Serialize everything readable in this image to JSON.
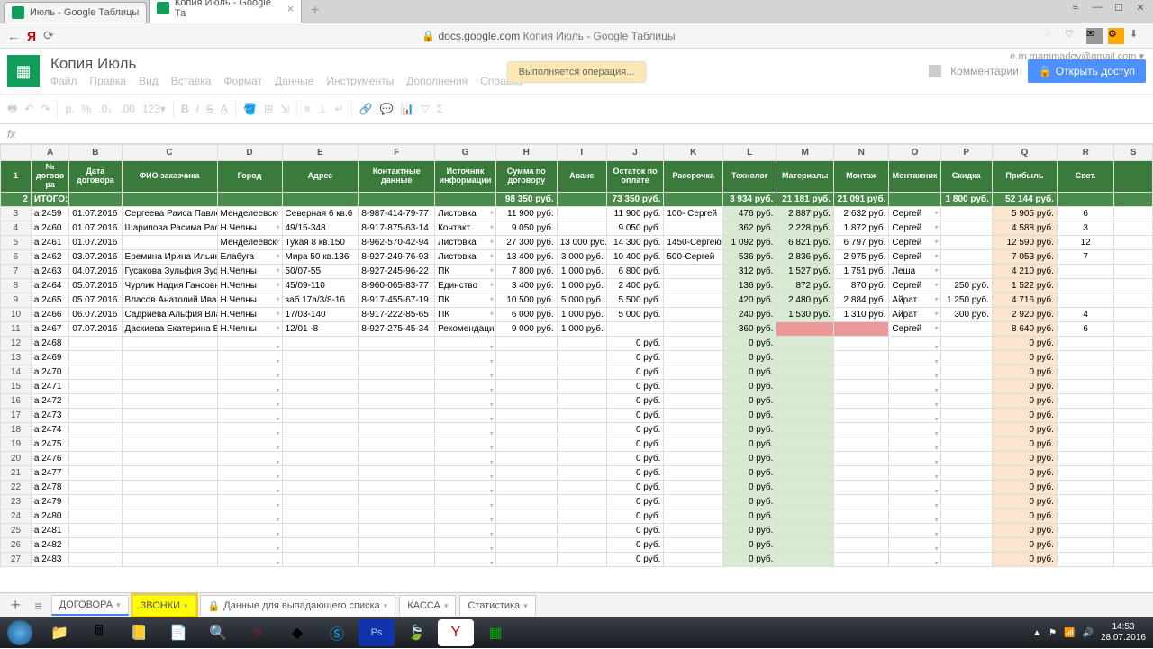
{
  "browser": {
    "tabs": [
      {
        "title": "Июль - Google Таблицы",
        "active": false
      },
      {
        "title": "Копия Июль - Google Та",
        "active": true
      }
    ],
    "url_host": "docs.google.com",
    "url_title": "Копия Июль - Google Таблицы"
  },
  "doc": {
    "title": "Копия Июль",
    "user_email": "e.m.mammadov@gmail.com ▾",
    "operation": "Выполняется операция...",
    "comments": "Комментарии",
    "share": "Открыть доступ"
  },
  "menus": [
    "Файл",
    "Правка",
    "Вид",
    "Вставка",
    "Формат",
    "Данные",
    "Инструменты",
    "Дополнения",
    "Справка"
  ],
  "columns": [
    "",
    "A",
    "B",
    "C",
    "D",
    "E",
    "F",
    "G",
    "H",
    "I",
    "J",
    "K",
    "L",
    "M",
    "N",
    "O",
    "P",
    "Q",
    "R",
    "S"
  ],
  "headers": [
    "№ догово ра",
    "Дата договора",
    "ФИО заказчика",
    "Город",
    "Адрес",
    "Контактные данные",
    "Источник информации",
    "Сумма по договору",
    "Аванс",
    "Остаток по оплате",
    "Рассрочка",
    "Технолог",
    "Материалы",
    "Монтаж",
    "Монтажник",
    "Скидка",
    "Прибыль",
    "Свет."
  ],
  "totals": {
    "label": "ИТОГО:",
    "H": "98 350 руб.",
    "J": "73 350 руб.",
    "L": "3 934 руб.",
    "M": "21 181 руб.",
    "N": "21 091 руб.",
    "P": "1 800 руб.",
    "Q": "52 144 руб."
  },
  "rows": [
    {
      "n": 3,
      "A": "а 2459",
      "B": "01.07.2016",
      "C": "Сергеева Раиса Павло",
      "D": "Менделеевск",
      "E": "Северная 6 кв.6",
      "F": "8-987-414-79-77",
      "G": "Листовка",
      "H": "11 900 руб.",
      "I": "",
      "J": "11 900 руб.",
      "K": "100- Сергей",
      "L": "476 руб.",
      "M": "2 887 руб.",
      "N": "2 632 руб.",
      "O": "Сергей",
      "P": "",
      "Q": "5 905 руб.",
      "R": "6"
    },
    {
      "n": 4,
      "A": "а 2460",
      "B": "01.07.2016",
      "C": "Шарипова Расима Раф",
      "D": "Н.Челны",
      "E": "49/15-348",
      "F": "8-917-875-63-14",
      "G": "Контакт",
      "H": "9 050 руб.",
      "I": "",
      "J": "9 050 руб.",
      "K": "",
      "L": "362 руб.",
      "M": "2 228 руб.",
      "N": "1 872 руб.",
      "O": "Сергей",
      "P": "",
      "Q": "4 588 руб.",
      "R": "3"
    },
    {
      "n": 5,
      "A": "а 2461",
      "B": "01.07.2016",
      "C": "",
      "D": "Менделеевск",
      "E": "Тукая 8 кв.150",
      "F": "8-962-570-42-94",
      "G": "Листовка",
      "H": "27 300 руб.",
      "I": "13 000 руб.",
      "J": "14 300 руб.",
      "K": "1450-Сергею",
      "L": "1 092 руб.",
      "M": "6 821 руб.",
      "N": "6 797 руб.",
      "O": "Сергей",
      "P": "",
      "Q": "12 590 руб.",
      "R": "12"
    },
    {
      "n": 6,
      "A": "а 2462",
      "B": "03.07.2016",
      "C": "Еремина Ирина Ильин",
      "D": "Елабуга",
      "E": "Мира 50 кв.136",
      "F": "8-927-249-76-93",
      "G": "Листовка",
      "H": "13 400 руб.",
      "I": "3 000 руб.",
      "J": "10 400 руб.",
      "K": "500-Сергей",
      "L": "536 руб.",
      "M": "2 836 руб.",
      "N": "2 975 руб.",
      "O": "Сергей",
      "P": "",
      "Q": "7 053 руб.",
      "R": "7"
    },
    {
      "n": 7,
      "A": "а 2463",
      "B": "04.07.2016",
      "C": "Гусакова Зульфия Зуф",
      "D": "Н.Челны",
      "E": "50/07-55",
      "F": "8-927-245-96-22",
      "G": "ПК",
      "H": "7 800 руб.",
      "I": "1 000 руб.",
      "J": "6 800 руб.",
      "K": "",
      "L": "312 руб.",
      "M": "1 527 руб.",
      "N": "1 751 руб.",
      "O": "Леша",
      "P": "",
      "Q": "4 210 руб.",
      "R": ""
    },
    {
      "n": 8,
      "A": "а 2464",
      "B": "05.07.2016",
      "C": "Чурлик Надия Гансовн",
      "D": "Н.Челны",
      "E": "45/09-110",
      "F": "8-960-065-83-77",
      "G": "Единство",
      "H": "3 400 руб.",
      "I": "1 000 руб.",
      "J": "2 400 руб.",
      "K": "",
      "L": "136 руб.",
      "M": "872 руб.",
      "N": "870 руб.",
      "O": "Сергей",
      "P": "250 руб.",
      "Q": "1 522 руб.",
      "R": ""
    },
    {
      "n": 9,
      "A": "а 2465",
      "B": "05.07.2016",
      "C": "Власов Анатолий Иван",
      "D": "Н.Челны",
      "E": "заб 17а/3/8-16",
      "F": "8-917-455-67-19",
      "G": "ПК",
      "H": "10 500 руб.",
      "I": "5 000 руб.",
      "J": "5 500 руб.",
      "K": "",
      "L": "420 руб.",
      "M": "2 480 руб.",
      "N": "2 884 руб.",
      "O": "Айрат",
      "P": "1 250 руб.",
      "Q": "4 716 руб.",
      "R": ""
    },
    {
      "n": 10,
      "A": "а 2466",
      "B": "06.07.2016",
      "C": "Садриева Альфия Вла",
      "D": "Н.Челны",
      "E": "17/03-140",
      "F": "8-917-222-85-65",
      "G": "ПК",
      "H": "6 000 руб.",
      "I": "1 000 руб.",
      "J": "5 000 руб.",
      "K": "",
      "L": "240 руб.",
      "M": "1 530 руб.",
      "N": "1 310 руб.",
      "O": "Айрат",
      "P": "300 руб.",
      "Q": "2 920 руб.",
      "R": "4"
    },
    {
      "n": 11,
      "A": "а 2467",
      "B": "07.07.2016",
      "C": "Даскиева Екатерина В",
      "D": "Н.Челны",
      "E": "12/01 -8",
      "F": "8-927-275-45-34",
      "G": "Рекомендаци",
      "H": "9 000 руб.",
      "I": "1 000 руб.",
      "J": "",
      "K": "",
      "L": "360 руб.",
      "M": "",
      "N": "",
      "O": "Сергей",
      "P": "",
      "Q": "8 640 руб.",
      "R": "6",
      "redMN": true
    },
    {
      "n": 12,
      "A": "а 2468",
      "J": "0 руб.",
      "L": "0 руб.",
      "Q": "0 руб."
    },
    {
      "n": 13,
      "A": "а 2469",
      "J": "0 руб.",
      "L": "0 руб.",
      "Q": "0 руб."
    },
    {
      "n": 14,
      "A": "а 2470",
      "J": "0 руб.",
      "L": "0 руб.",
      "Q": "0 руб."
    },
    {
      "n": 15,
      "A": "а 2471",
      "J": "0 руб.",
      "L": "0 руб.",
      "Q": "0 руб."
    },
    {
      "n": 16,
      "A": "а 2472",
      "J": "0 руб.",
      "L": "0 руб.",
      "Q": "0 руб."
    },
    {
      "n": 17,
      "A": "а 2473",
      "J": "0 руб.",
      "L": "0 руб.",
      "Q": "0 руб."
    },
    {
      "n": 18,
      "A": "а 2474",
      "J": "0 руб.",
      "L": "0 руб.",
      "Q": "0 руб."
    },
    {
      "n": 19,
      "A": "а 2475",
      "J": "0 руб.",
      "L": "0 руб.",
      "Q": "0 руб."
    },
    {
      "n": 20,
      "A": "а 2476",
      "J": "0 руб.",
      "L": "0 руб.",
      "Q": "0 руб."
    },
    {
      "n": 21,
      "A": "а 2477",
      "J": "0 руб.",
      "L": "0 руб.",
      "Q": "0 руб."
    },
    {
      "n": 22,
      "A": "а 2478",
      "J": "0 руб.",
      "L": "0 руб.",
      "Q": "0 руб."
    },
    {
      "n": 23,
      "A": "а 2479",
      "J": "0 руб.",
      "L": "0 руб.",
      "Q": "0 руб."
    },
    {
      "n": 24,
      "A": "а 2480",
      "J": "0 руб.",
      "L": "0 руб.",
      "Q": "0 руб."
    },
    {
      "n": 25,
      "A": "а 2481",
      "J": "0 руб.",
      "L": "0 руб.",
      "Q": "0 руб."
    },
    {
      "n": 26,
      "A": "а 2482",
      "J": "0 руб.",
      "L": "0 руб.",
      "Q": "0 руб."
    },
    {
      "n": 27,
      "A": "а 2483",
      "J": "0 руб.",
      "L": "0 руб.",
      "Q": "0 руб."
    }
  ],
  "sheet_tabs": [
    {
      "label": "ДОГОВОРА"
    },
    {
      "label": "ЗВОНКИ",
      "highlight": true
    },
    {
      "label": "Данные для выпадающего списка",
      "locked": true
    },
    {
      "label": "КАССА"
    },
    {
      "label": "Статистика"
    }
  ],
  "taskbar": {
    "time": "14:53",
    "date": "28.07.2016"
  }
}
